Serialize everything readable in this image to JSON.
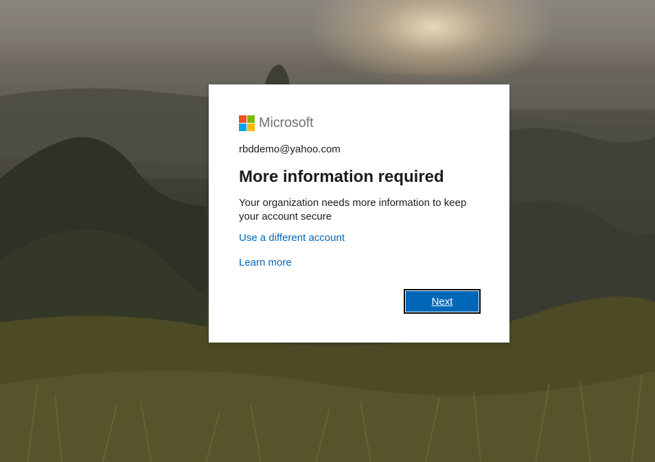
{
  "brand": {
    "name": "Microsoft",
    "logo_colors": [
      "#f25022",
      "#7fba00",
      "#00a4ef",
      "#ffb900"
    ]
  },
  "account": {
    "email": "rbddemo@yahoo.com"
  },
  "content": {
    "title": "More information required",
    "description": "Your organization needs more information to keep your account secure"
  },
  "links": {
    "different_account": "Use a different account",
    "learn_more": "Learn more"
  },
  "actions": {
    "next_label": "Next"
  },
  "colors": {
    "link": "#0067b8",
    "button_bg": "#0067b8",
    "text": "#1b1b1b"
  }
}
